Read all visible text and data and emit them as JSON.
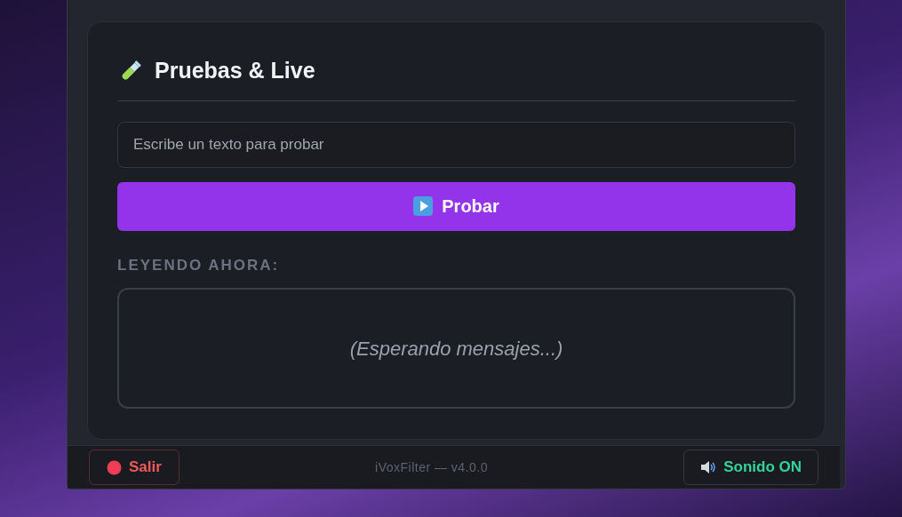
{
  "panel": {
    "title": "Pruebas & Live",
    "input": {
      "placeholder": "Escribe un texto para probar"
    },
    "test_button": "Probar",
    "reading_label": "LEYENDO AHORA:",
    "reading_text": "(Esperando mensajes...)"
  },
  "footer": {
    "exit_button": "Salir",
    "version": "iVoxFilter — v4.0.0",
    "sound": {
      "label": "Sonido ON",
      "on": true
    }
  }
}
